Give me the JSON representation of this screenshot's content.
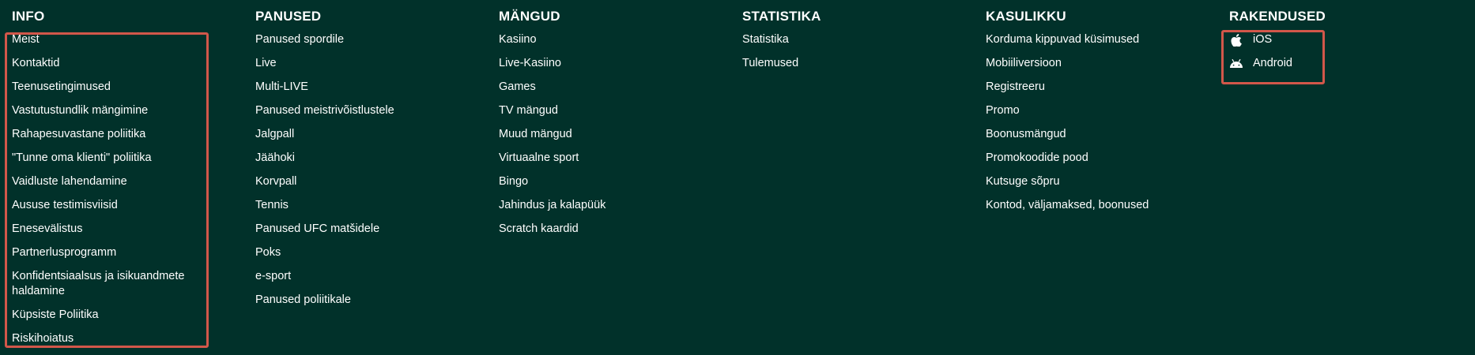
{
  "colors": {
    "background": "#01312a",
    "text": "#ffffff",
    "highlight_border": "#d2574a"
  },
  "columns": {
    "info": {
      "title": "INFO",
      "items": [
        "Meist",
        "Kontaktid",
        "Teenusetingimused",
        "Vastutustundlik mängimine",
        "Rahapesuvastane poliitika",
        "\"Tunne oma klienti\" poliitika",
        "Vaidluste lahendamine",
        "Aususe testimisviisid",
        "Enesevälistus",
        "Partnerlusprogramm",
        "Konfidentsiaalsus ja isikuandmete haldamine",
        "Küpsiste Poliitika",
        "Riskihoiatus"
      ]
    },
    "panused": {
      "title": "PANUSED",
      "items": [
        "Panused spordile",
        "Live",
        "Multi-LIVE",
        "Panused meistrivõistlustele",
        "Jalgpall",
        "Jäähoki",
        "Korvpall",
        "Tennis",
        "Panused UFC matšidele",
        "Poks",
        "e-sport",
        "Panused poliitikale"
      ]
    },
    "mangud": {
      "title": "MÄNGUD",
      "items": [
        "Kasiino",
        "Live-Kasiino",
        "Games",
        "TV mängud",
        "Muud mängud",
        "Virtuaalne sport",
        "Bingo",
        "Jahindus ja kalapüük",
        "Scratch kaardid"
      ]
    },
    "statistika": {
      "title": "STATISTIKA",
      "items": [
        "Statistika",
        "Tulemused"
      ]
    },
    "kasulikku": {
      "title": "KASULIKKU",
      "items": [
        "Korduma kippuvad küsimused",
        "Mobiiliversioon",
        "Registreeru",
        "Promo",
        "Boonusmängud",
        "Promokoodide pood",
        "Kutsuge sõpru",
        "Kontod, väljamaksed, boonused"
      ]
    },
    "rakendused": {
      "title": "RAKENDUSED",
      "items": [
        {
          "label": "iOS",
          "icon": "apple-icon"
        },
        {
          "label": "Android",
          "icon": "android-icon"
        }
      ]
    }
  }
}
